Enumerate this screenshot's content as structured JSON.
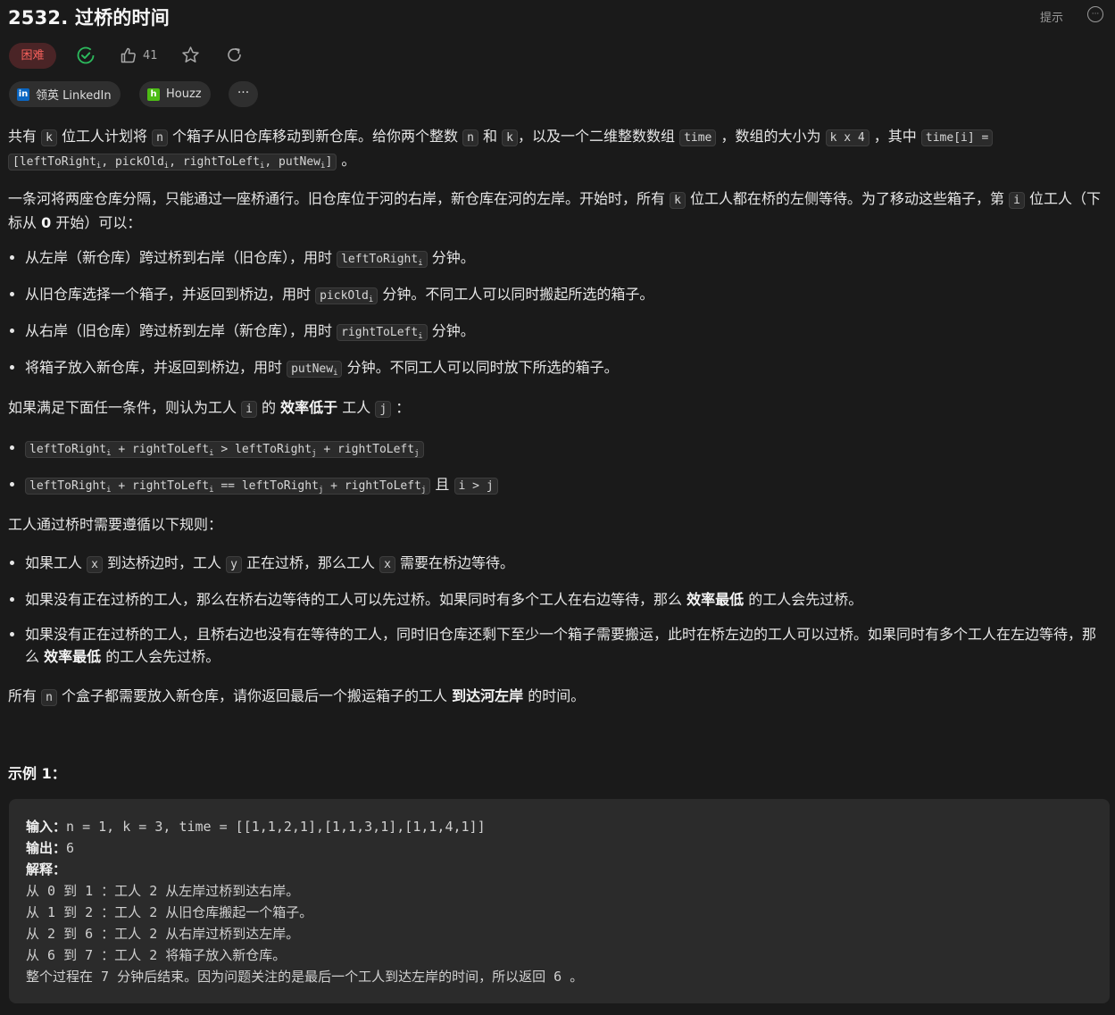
{
  "header": {
    "title": "2532. 过桥的时间",
    "hint_label": "提示"
  },
  "meta": {
    "difficulty": "困难",
    "difficulty_color": "#f8615c",
    "solved_color": "#2cbb5d",
    "likes": "41"
  },
  "companies": [
    {
      "name": "领英 LinkedIn",
      "logo": "in",
      "logo_color": "#0a66c2"
    },
    {
      "name": "Houzz",
      "logo": "h",
      "logo_color": "#4dbc15"
    }
  ],
  "description": {
    "p1": [
      "共有 ",
      "k",
      " 位工人计划将 ",
      "n",
      " 个箱子从旧仓库移动到新仓库。给你两个整数 ",
      "n",
      " 和 ",
      "k",
      "，以及一个二维整数数组 ",
      "time",
      " ，数组的大小为 ",
      "k x 4",
      " ，其中 ",
      "time[i] =",
      "[leftToRight",
      "i",
      ", pickOld",
      "i",
      ", rightToLeft",
      "i",
      ", putNew",
      "i",
      "]",
      " 。"
    ],
    "p2": [
      "一条河将两座仓库分隔，只能通过一座桥通行。旧仓库位于河的右岸，新仓库在河的左岸。开始时，所有 ",
      "k",
      " 位工人都在桥的左侧等待。为了移动这些箱子，第 ",
      "i",
      " 位工人（下标从 ",
      "0",
      " 开始）可以："
    ],
    "steps": [
      {
        "pre": "从左岸（新仓库）跨过桥到右岸（旧仓库），用时 ",
        "code": "leftToRight",
        "sub": "i",
        "post": " 分钟。"
      },
      {
        "pre": "从旧仓库选择一个箱子，并返回到桥边，用时 ",
        "code": "pickOld",
        "sub": "i",
        "post": " 分钟。不同工人可以同时搬起所选的箱子。"
      },
      {
        "pre": "从右岸（旧仓库）跨过桥到左岸（新仓库），用时 ",
        "code": "rightToLeft",
        "sub": "i",
        "post": " 分钟。"
      },
      {
        "pre": "将箱子放入新仓库，并返回到桥边，用时 ",
        "code": "putNew",
        "sub": "i",
        "post": " 分钟。不同工人可以同时放下所选的箱子。"
      }
    ],
    "p3": [
      "如果满足下面任一条件，则认为工人 ",
      "i",
      " 的 ",
      "效率低于",
      " 工人 ",
      "j",
      " ："
    ],
    "cond1": [
      "leftToRight",
      "i",
      " + rightToLeft",
      "i",
      " > leftToRight",
      "j",
      " + rightToLeft",
      "j"
    ],
    "cond2": [
      "leftToRight",
      "i",
      " + rightToLeft",
      "i",
      " == leftToRight",
      "j",
      " + rightToLeft",
      "j",
      " 且 ",
      "i > j"
    ],
    "p4": "工人通过桥时需要遵循以下规则：",
    "rules": [
      [
        "如果工人 ",
        "x",
        " 到达桥边时，工人 ",
        "y",
        " 正在过桥，那么工人 ",
        "x",
        " 需要在桥边等待。"
      ],
      [
        "如果没有正在过桥的工人，那么在桥右边等待的工人可以先过桥。如果同时有多个工人在右边等待，那么 ",
        "效率最低",
        " 的工人会先过桥。"
      ],
      [
        "如果没有正在过桥的工人，且桥右边也没有在等待的工人，同时旧仓库还剩下至少一个箱子需要搬运，此时在桥左边的工人可以过桥。如果同时有多个工人在左边等待，那么 ",
        "效率最低",
        " 的工人会先过桥。"
      ]
    ],
    "p5": [
      "所有 ",
      "n",
      " 个盒子都需要放入新仓库，请你返回最后一个搬运箱子的工人 ",
      "到达河左岸",
      " 的时间。"
    ]
  },
  "example": {
    "title": "示例 1：",
    "input_label": "输入：",
    "input": "n = 1, k = 3, time = [[1,1,2,1],[1,1,3,1],[1,1,4,1]]",
    "output_label": "输出：",
    "output": "6",
    "explain_label": "解释：",
    "explain": [
      "从 0 到 1 ：工人 2 从左岸过桥到达右岸。",
      "从 1 到 2 ：工人 2 从旧仓库搬起一个箱子。",
      "从 2 到 6 ：工人 2 从右岸过桥到达左岸。",
      "从 6 到 7 ：工人 2 将箱子放入新仓库。",
      "整个过程在 7 分钟后结束。因为问题关注的是最后一个工人到达左岸的时间，所以返回 6 。"
    ]
  }
}
